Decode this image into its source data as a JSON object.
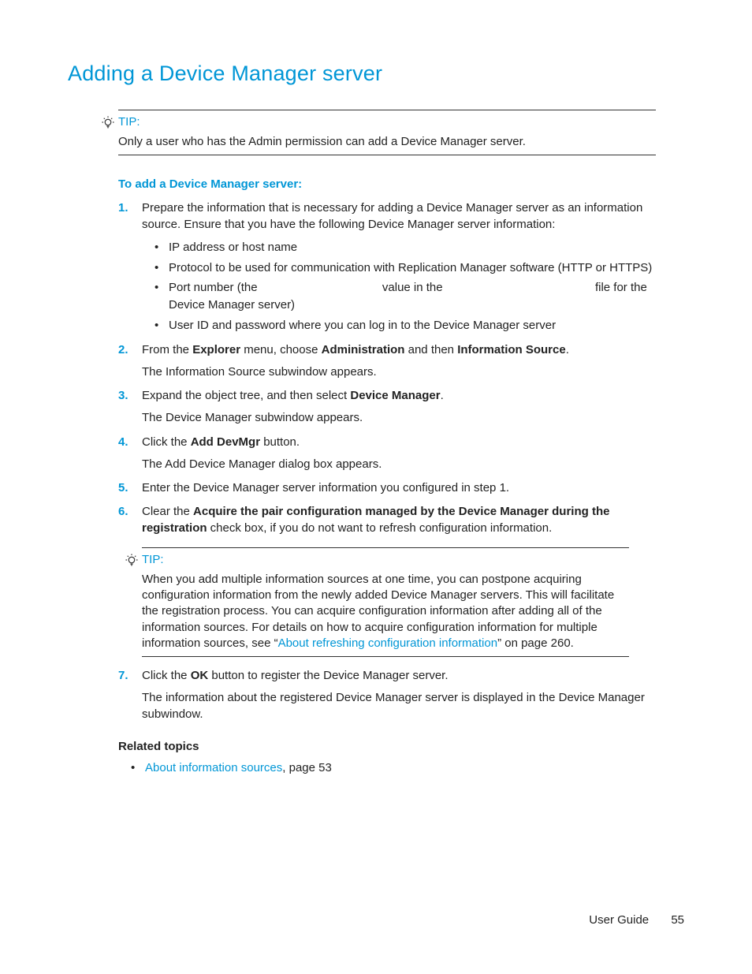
{
  "heading": "Adding a Device Manager server",
  "tip1": {
    "label": "TIP:",
    "body": "Only a user who has the Admin permission can add a Device Manager server."
  },
  "procedure_heading": "To add a Device Manager server:",
  "steps": {
    "s1": {
      "text_a": "Prepare the information that is necessary for adding a Device Manager server as an information source. Ensure that you have the following Device Manager server information:",
      "bullets": {
        "b1": "IP address or host name",
        "b2": "Protocol to be used for communication with Replication Manager software (HTTP or HTTPS)",
        "b3_a": "Port number (the ",
        "b3_b": " value in the ",
        "b3_c": " file for the Device Manager server)",
        "b4": "User ID and password where you can log in to the Device Manager server"
      }
    },
    "s2": {
      "a": "From the ",
      "explorer": "Explorer",
      "b": " menu, choose ",
      "admin": "Administration",
      "c": " and then ",
      "info": "Information Source",
      "d": ".",
      "follow": "The Information Source subwindow appears."
    },
    "s3": {
      "a": "Expand the object tree, and then select ",
      "dm": "Device Manager",
      "b": ".",
      "follow": "The Device Manager subwindow appears."
    },
    "s4": {
      "a": "Click the ",
      "btn": "Add DevMgr",
      "b": " button.",
      "follow": "The Add Device Manager dialog box appears."
    },
    "s5": {
      "text": "Enter the Device Manager server information you configured in step 1."
    },
    "s6": {
      "a": "Clear the ",
      "bold": "Acquire the pair configuration managed by the Device Manager during the registration",
      "b": " check box, if you do not want to refresh configuration information."
    },
    "s7": {
      "a": "Click the ",
      "ok": "OK",
      "b": " button to register the Device Manager server.",
      "follow": "The information about the registered Device Manager server is displayed in the Device Manager subwindow."
    }
  },
  "tip2": {
    "label": "TIP:",
    "body_a": "When you add multiple information sources at one time, you can postpone acquiring configuration information from the newly added Device Manager servers. This will facilitate the registration process. You can acquire configuration information after adding all of the information sources. For details on how to acquire configuration information for multiple information sources, see “",
    "link": "About refreshing configuration information",
    "body_b": "” on page 260."
  },
  "related": {
    "heading": "Related topics",
    "item_link": "About information sources",
    "item_suffix": ", page 53"
  },
  "footer": {
    "label": "User Guide",
    "page": "55"
  }
}
